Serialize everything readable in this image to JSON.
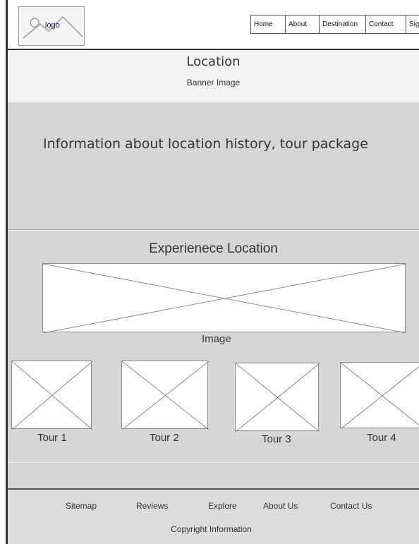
{
  "header": {
    "logo_label": "logo",
    "nav": [
      "Home",
      "About",
      "Destination",
      "Contact",
      "Sign"
    ]
  },
  "banner": {
    "title": "Location",
    "subtitle": "Banner Image"
  },
  "info": {
    "text": "Information about location history, tour package"
  },
  "experience": {
    "title": "Experienece Location",
    "image_caption": "Image",
    "tours": [
      "Tour 1",
      "Tour 2",
      "Tour 3",
      "Tour 4"
    ]
  },
  "footer": {
    "links": [
      "Sitemap",
      "Reviews",
      "Explore",
      "About Us",
      "Contact Us"
    ],
    "copyright": "Copyright Information"
  },
  "colors": {
    "section_gray": "#d6d6d6",
    "banner_bg": "#f3f3f3",
    "footer_bg": "#dcdcdc",
    "placeholder_stroke": "#8a8a8a"
  }
}
